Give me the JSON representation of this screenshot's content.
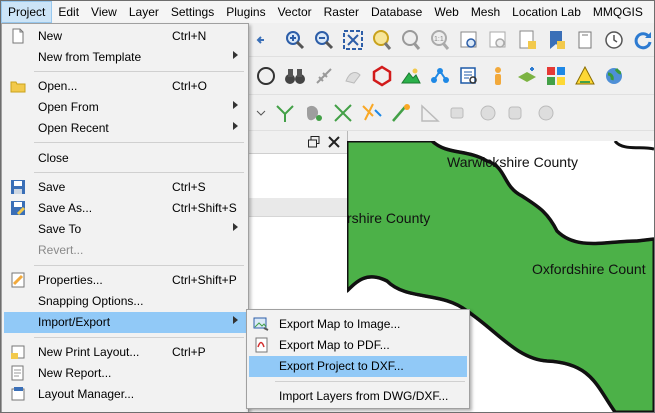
{
  "menubar": {
    "items": [
      "Project",
      "Edit",
      "View",
      "Layer",
      "Settings",
      "Plugins",
      "Vector",
      "Raster",
      "Database",
      "Web",
      "Mesh",
      "Location Lab",
      "MMQGIS"
    ]
  },
  "project_menu": {
    "items": [
      {
        "label": "New",
        "shortcut": "Ctrl+N"
      },
      {
        "label": "New from Template"
      },
      {
        "label": "Open...",
        "shortcut": "Ctrl+O"
      },
      {
        "label": "Open From"
      },
      {
        "label": "Open Recent"
      },
      {
        "label": "Close"
      },
      {
        "label": "Save",
        "shortcut": "Ctrl+S"
      },
      {
        "label": "Save As...",
        "shortcut": "Ctrl+Shift+S"
      },
      {
        "label": "Save To"
      },
      {
        "label": "Revert..."
      },
      {
        "label": "Properties...",
        "shortcut": "Ctrl+Shift+P"
      },
      {
        "label": "Snapping Options..."
      },
      {
        "label": "Import/Export"
      },
      {
        "label": "New Print Layout...",
        "shortcut": "Ctrl+P"
      },
      {
        "label": "New Report..."
      },
      {
        "label": "Layout Manager..."
      }
    ]
  },
  "submenu": {
    "items": [
      {
        "label": "Export Map to Image..."
      },
      {
        "label": "Export Map to PDF..."
      },
      {
        "label": "Export Project to DXF..."
      },
      {
        "label": "Import Layers from DWG/DXF..."
      }
    ]
  },
  "map": {
    "labels": [
      "Warwickshire County",
      "rshire County",
      "Oxfordshire Count"
    ],
    "fill_color": "#4cb148",
    "border_color": "#111111"
  },
  "colors": {
    "highlight": "#91c9f7",
    "menu_bg": "#f2f2f2"
  }
}
